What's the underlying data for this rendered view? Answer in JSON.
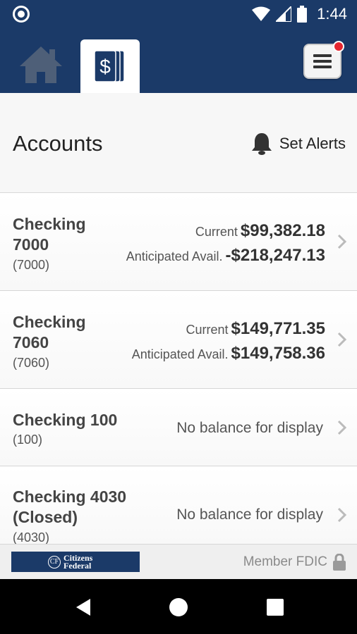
{
  "status_bar": {
    "time": "1:44",
    "icons": [
      "notification-dot-icon",
      "wifi-icon",
      "signal-icon",
      "battery-icon"
    ]
  },
  "nav": {
    "home_icon": "home-icon",
    "accounts_icon": "dollar-cards-icon",
    "menu_icon": "hamburger-menu-icon",
    "menu_has_badge": true,
    "colors": {
      "brand": "#1b3a68",
      "badge": "#e52630"
    }
  },
  "header": {
    "title": "Accounts",
    "alerts_label": "Set Alerts",
    "alerts_icon": "bell-icon"
  },
  "accounts": [
    {
      "name_line1": "Checking",
      "name_line2": "7000",
      "number": "(7000)",
      "current_label": "Current",
      "current_value": "$99,382.18",
      "avail_label": "Anticipated Avail.",
      "avail_value": "-$218,247.13"
    },
    {
      "name_line1": "Checking",
      "name_line2": "7060",
      "number": "(7060)",
      "current_label": "Current",
      "current_value": "$149,771.35",
      "avail_label": "Anticipated Avail.",
      "avail_value": "$149,758.36"
    },
    {
      "name_line1": "Checking 100",
      "number": "(100)",
      "no_balance": "No balance for display"
    },
    {
      "name_line1": "Checking 4030",
      "name_line2": "(Closed)",
      "number": "(4030)",
      "no_balance": "No balance for display"
    }
  ],
  "footer": {
    "logo_text": "Citizens Federal",
    "fdic_label": "Member FDIC",
    "lock_icon": "lock-icon"
  },
  "android_nav": [
    "back-icon",
    "home-circle-icon",
    "recents-icon"
  ]
}
